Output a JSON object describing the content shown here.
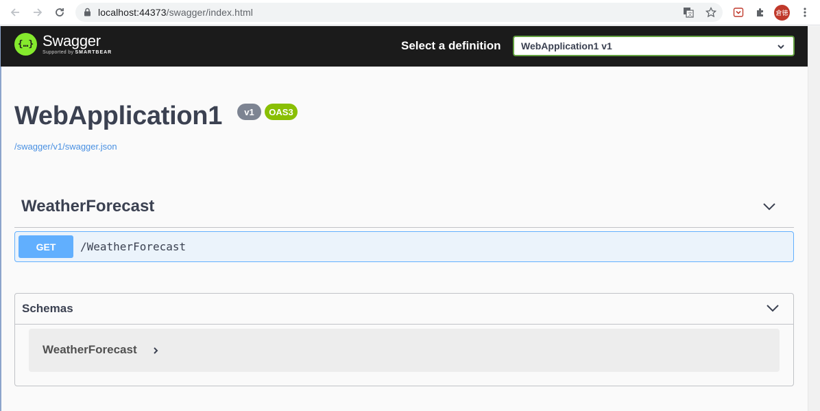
{
  "browser": {
    "url_host": "localhost:44373",
    "url_path": "/swagger/index.html",
    "profile_initials": "倉徳"
  },
  "topbar": {
    "logo_name": "Swagger",
    "logo_supported": "Supported by",
    "logo_brand": "SMARTBEAR",
    "select_label": "Select a definition",
    "selected_definition": "WebApplication1 v1"
  },
  "info": {
    "title": "WebApplication1",
    "version_badge": "v1",
    "oas_badge": "OAS3",
    "spec_link": "/swagger/v1/swagger.json"
  },
  "tags": [
    {
      "name": "WeatherForecast",
      "operations": [
        {
          "method": "GET",
          "path": "/WeatherForecast"
        }
      ]
    }
  ],
  "schemas": {
    "title": "Schemas",
    "models": [
      {
        "name": "WeatherForecast"
      }
    ]
  },
  "colors": {
    "topbar_bg": "#1b1b1b",
    "swagger_green": "#85ea2d",
    "get_blue": "#61affe",
    "oas_green": "#89bf04",
    "version_grey": "#7d8492"
  }
}
